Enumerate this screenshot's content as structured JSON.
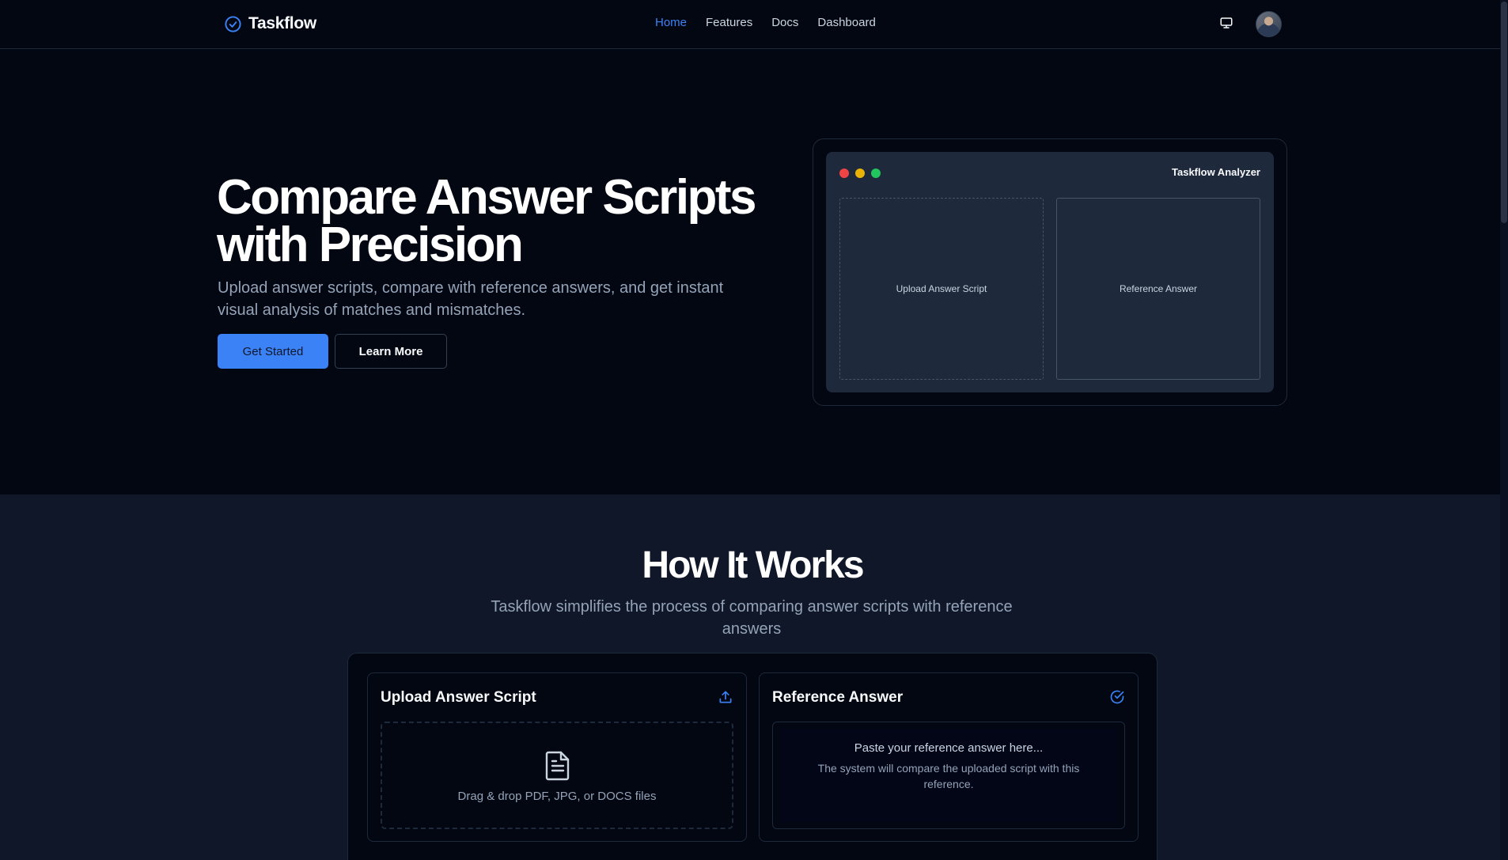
{
  "nav": {
    "brand": "Taskflow",
    "links": [
      "Home",
      "Features",
      "Docs",
      "Dashboard"
    ],
    "active_link": "Home",
    "icons": [
      "check-circle-icon",
      "monitor-icon",
      "avatar"
    ]
  },
  "hero": {
    "title": "Compare Answer Scripts with Precision",
    "subtitle": "Upload answer scripts, compare with reference answers, and get instant visual analysis of matches and mismatches.",
    "primary_button": "Get Started",
    "secondary_button": "Learn More"
  },
  "analyzer": {
    "title": "Taskflow Analyzer",
    "left_panel": "Upload Answer Script",
    "right_panel": "Reference Answer"
  },
  "how": {
    "title": "How It Works",
    "subtitle": "Taskflow simplifies the process of comparing answer scripts with reference answers",
    "upload_card": {
      "title": "Upload Answer Script",
      "drop_text": "Drag & drop PDF, JPG, or DOCS files"
    },
    "reference_card": {
      "title": "Reference Answer",
      "placeholder": "Paste your reference answer here...",
      "note": "The system will compare the uploaded script with this reference."
    }
  },
  "colors": {
    "background": "#030711",
    "section_background": "#0f1729",
    "accent": "#3b82f6",
    "muted_text": "#94a3b8",
    "border": "#1e293b"
  }
}
